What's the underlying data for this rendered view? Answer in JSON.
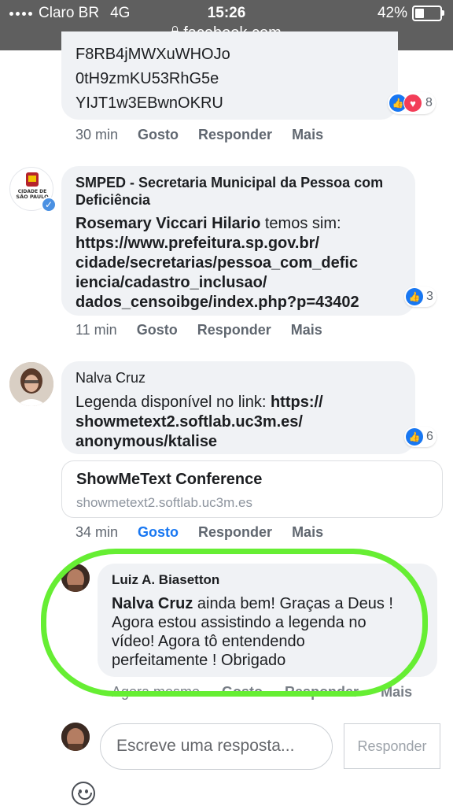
{
  "status_bar": {
    "carrier": "Claro BR",
    "network": "4G",
    "time": "15:26",
    "battery_percent": "42%",
    "battery_level": 0.42,
    "url": "facebook.com"
  },
  "comment1": {
    "text_lines": "F8RB4jMWXuWHOJo\n0tH9zmKU53RhG5e\nYIJT1w3EBwnOKRU",
    "reaction_count": "8",
    "reaction_icons": [
      "like-icon",
      "love-icon"
    ],
    "actions": {
      "time": "30 min",
      "like": "Gosto",
      "reply": "Responder",
      "more": "Mais"
    }
  },
  "comment2": {
    "author": "SMPED - Secretaria Municipal da Pessoa com Deficiência",
    "avatar_text": "CIDADE DE SÃO PAULO",
    "mention": "Rosemary Viccari Hilario",
    "text": " temos sim:",
    "link": "https://www.prefeitura.sp.gov.br/\ncidade/secretarias/pessoa_com_defic\niencia/cadastro_inclusao/\ndados_censoibge/index.php?p=43402",
    "reaction_count": "3",
    "actions": {
      "time": "11 min",
      "like": "Gosto",
      "reply": "Responder",
      "more": "Mais"
    }
  },
  "comment3": {
    "author": "Nalva Cruz",
    "text": "Legenda disponível no link: ",
    "link": "https://\nshowmetext2.softlab.uc3m.es/\nanonymous/ktalise",
    "reaction_count": "6",
    "link_preview": {
      "title": "ShowMeText Conference",
      "domain": "showmetext2.softlab.uc3m.es"
    },
    "actions": {
      "time": "34 min",
      "like": "Gosto",
      "reply": "Responder",
      "more": "Mais"
    }
  },
  "reply1": {
    "author": "Luiz A. Biasetton",
    "mention": "Nalva Cruz",
    "text": " ainda bem! Graças a Deus !\nAgora estou assistindo a legenda no\nvídeo! Agora tô entendendo\nperfeitamente ! Obrigado",
    "actions": {
      "time": "Agora mesmo",
      "like": "Gosto",
      "reply": "Responder",
      "more": "Mais"
    }
  },
  "composer": {
    "placeholder": "Escreve uma resposta...",
    "submit_label": "Responder"
  },
  "colors": {
    "highlight": "#66ee33",
    "like_active": "#1877f2",
    "bubble": "#f0f2f5"
  }
}
